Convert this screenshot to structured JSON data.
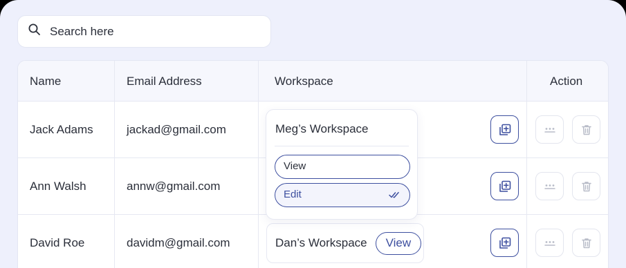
{
  "search": {
    "placeholder": "Search here"
  },
  "table": {
    "headers": {
      "name": "Name",
      "email": "Email Address",
      "workspace": "Workspace",
      "action": "Action"
    },
    "rows": [
      {
        "name": "Jack Adams",
        "email": "jackad@gmail.com",
        "workspace": "Meg’s Workspace"
      },
      {
        "name": "Ann Walsh",
        "email": "annw@gmail.com",
        "workspace": ""
      },
      {
        "name": "David Roe",
        "email": "davidm@gmail.com",
        "workspace": "Dan’s Workspace",
        "workspace_action": "View"
      }
    ]
  },
  "dropdown": {
    "title": "Meg’s Workspace",
    "options": [
      {
        "label": "View",
        "selected": false
      },
      {
        "label": "Edit",
        "selected": true
      }
    ]
  },
  "icons": {
    "search": "search-icon",
    "add": "add-copy-icon",
    "more": "more-dots-icon",
    "delete": "trash-icon",
    "check": "double-check-icon"
  },
  "colors": {
    "background": "#eef0fc",
    "accent": "#3d4f9f",
    "text": "#2b2f3a",
    "muted_icon": "#b8bcc8"
  }
}
